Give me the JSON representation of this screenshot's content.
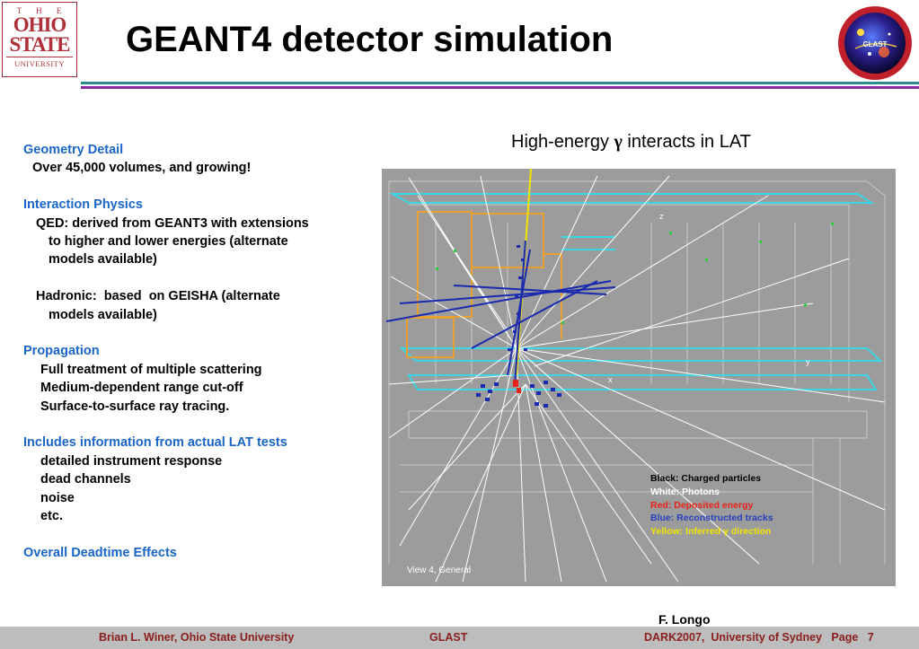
{
  "header": {
    "title": "GEANT4 detector simulation",
    "logo_left": {
      "line1": "T H E",
      "line2": "OHIO",
      "line3": "STATE",
      "line4": "UNIVERSITY"
    },
    "logo_right": "GLAST"
  },
  "left_panel": {
    "geometry_heading": "Geometry Detail",
    "geometry_text": "Over 45,000 volumes, and growing!",
    "interaction_heading": "Interaction Physics",
    "qed_line1": "QED: derived from GEANT3 with extensions",
    "qed_line2": "to higher and lower energies (alternate",
    "qed_line3": "models available)",
    "hadronic_line1": "Hadronic:  based  on GEISHA (alternate",
    "hadronic_line2": "models available)",
    "propagation_heading": "Propagation",
    "propagation_items": [
      "Full treatment of multiple scattering",
      "Medium-dependent range cut-off",
      "Surface-to-surface ray tracing."
    ],
    "lat_heading": "Includes information from actual LAT tests",
    "lat_items": [
      "detailed instrument response",
      "dead channels",
      "noise",
      "etc."
    ],
    "deadtime_heading": "Overall Deadtime Effects"
  },
  "figure": {
    "caption_before": "High-energy ",
    "caption_gamma": "γ",
    "caption_after": " interacts in LAT",
    "axis_z": "z",
    "axis_y": "y",
    "axis_x": "x",
    "view_label": "View 4, General",
    "legend": [
      {
        "text": "Black: Charged particles",
        "color": "#000000"
      },
      {
        "text": "White: Photons",
        "color": "#ffffff"
      },
      {
        "text": "Red: Deposited energy",
        "color": "#e8231a"
      },
      {
        "text": "Blue: Reconstructed tracks",
        "color": "#2a3fbf"
      },
      {
        "text": "Yellow: Inferred γ direction",
        "color": "#f2e600"
      }
    ],
    "colors": {
      "background": "#9c9c9c",
      "cyan_frame": "#39d6e6",
      "orange_frame": "#e8a030",
      "green_hits": "#2ecc40"
    }
  },
  "author": "F. Longo",
  "footer": {
    "left": "Brian L. Winer, Ohio State University",
    "center": "GLAST",
    "right": "DARK2007,  University of Sydney   Page   7"
  },
  "colors": {
    "rule_teal": "#2a8c8c",
    "rule_purple": "#8a2a9c",
    "heading_blue": "#1a66c8",
    "footer_text": "#8b1d1d",
    "footer_bg": "#bdbdbd"
  }
}
